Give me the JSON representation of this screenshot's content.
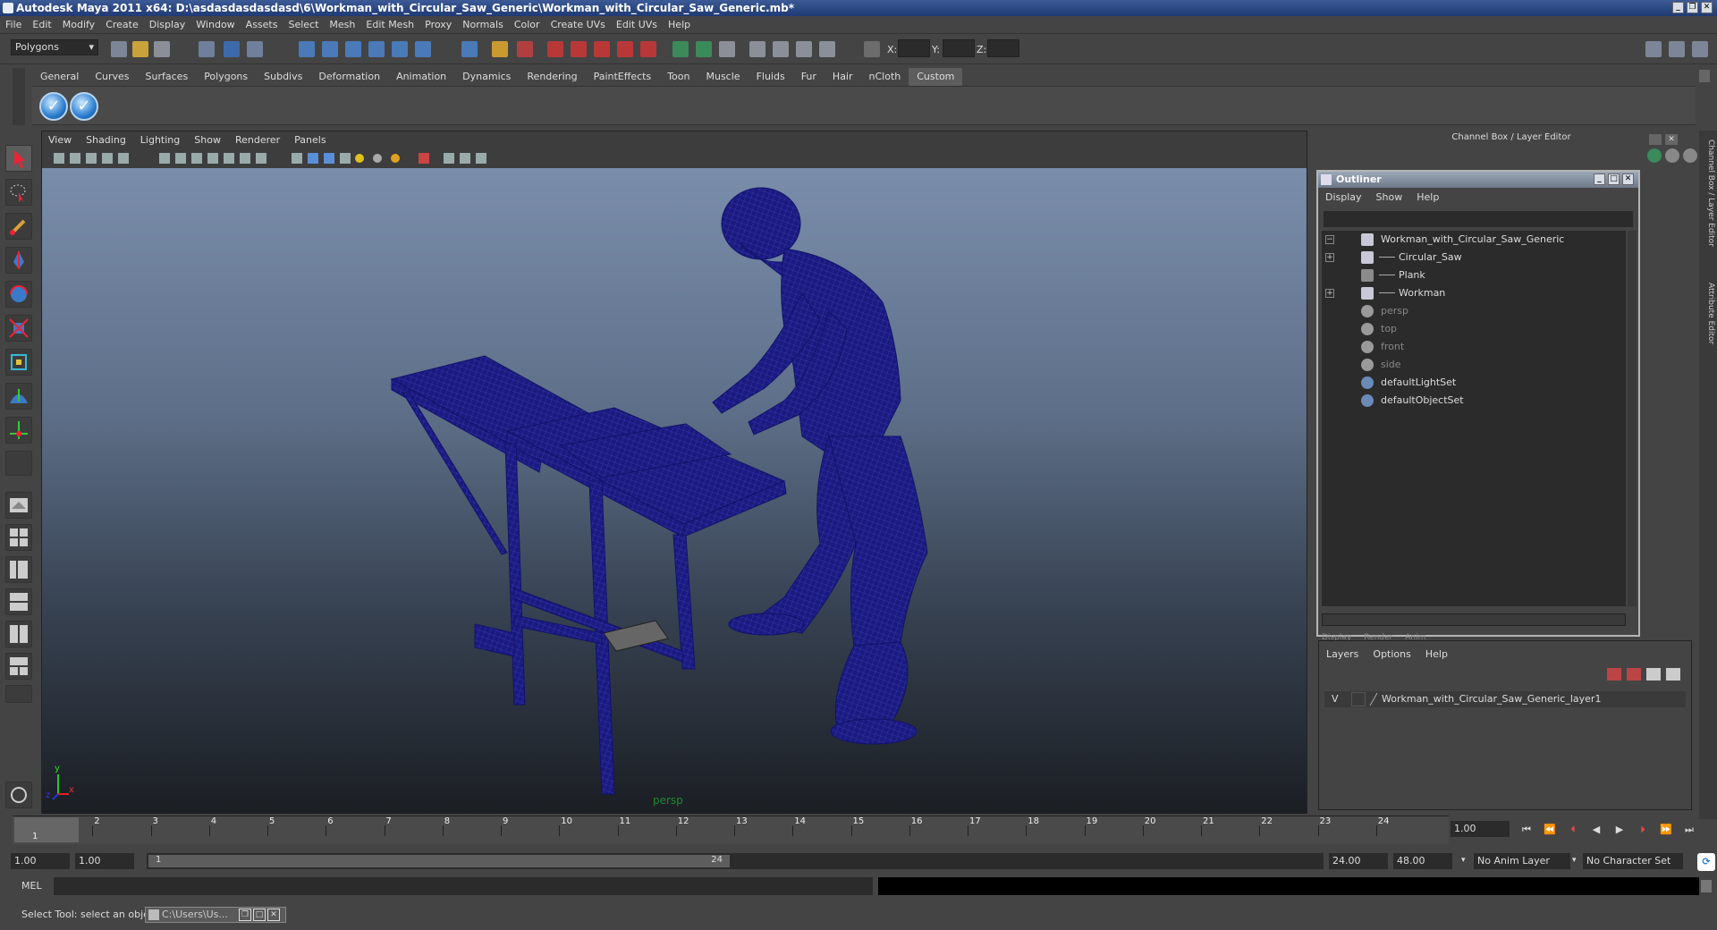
{
  "window": {
    "title": "Autodesk Maya 2011 x64: D:\\asdasdasdasdasd\\6\\Workman_with_Circular_Saw_Generic\\Workman_with_Circular_Saw_Generic.mb*"
  },
  "menubar": [
    "File",
    "Edit",
    "Modify",
    "Create",
    "Display",
    "Window",
    "Assets",
    "Select",
    "Mesh",
    "Edit Mesh",
    "Proxy",
    "Normals",
    "Color",
    "Create UVs",
    "Edit UVs",
    "Help"
  ],
  "status_line": {
    "mode": "Polygons",
    "x_label": "X:",
    "y_label": "Y:",
    "z_label": "Z:"
  },
  "shelf_tabs": [
    "General",
    "Curves",
    "Surfaces",
    "Polygons",
    "Subdivs",
    "Deformation",
    "Animation",
    "Dynamics",
    "Rendering",
    "PaintEffects",
    "Toon",
    "Muscle",
    "Fluids",
    "Fur",
    "Hair",
    "nCloth",
    "Custom"
  ],
  "active_shelf": "Custom",
  "viewport": {
    "menu": [
      "View",
      "Shading",
      "Lighting",
      "Show",
      "Renderer",
      "Panels"
    ],
    "camera": "persp",
    "axis_y": "y",
    "axis_x": "x",
    "axis_z": "z"
  },
  "channel_box": {
    "title": "Channel Box / Layer Editor"
  },
  "outliner": {
    "title": "Outliner",
    "menu": [
      "Display",
      "Show",
      "Help"
    ],
    "items": [
      {
        "label": "Workman_with_Circular_Saw_Generic",
        "expand": "−",
        "indent": 0,
        "icon": "transform-icon",
        "dim": false
      },
      {
        "label": "Circular_Saw",
        "expand": "+",
        "indent": 1,
        "icon": "transform-icon",
        "dim": false
      },
      {
        "label": "Plank",
        "expand": "",
        "indent": 1,
        "icon": "mesh-icon",
        "dim": false
      },
      {
        "label": "Workman",
        "expand": "+",
        "indent": 1,
        "icon": "transform-icon",
        "dim": false
      },
      {
        "label": "persp",
        "expand": "",
        "indent": 0,
        "icon": "camera-icon",
        "dim": true
      },
      {
        "label": "top",
        "expand": "",
        "indent": 0,
        "icon": "camera-icon",
        "dim": true
      },
      {
        "label": "front",
        "expand": "",
        "indent": 0,
        "icon": "camera-icon",
        "dim": true
      },
      {
        "label": "side",
        "expand": "",
        "indent": 0,
        "icon": "camera-icon",
        "dim": true
      },
      {
        "label": "defaultLightSet",
        "expand": "",
        "indent": 0,
        "icon": "set-icon",
        "dim": false
      },
      {
        "label": "defaultObjectSet",
        "expand": "",
        "indent": 0,
        "icon": "set-icon",
        "dim": false
      }
    ]
  },
  "layer_editor": {
    "tabs": [
      "Display",
      "Render",
      "Anim"
    ],
    "menu": [
      "Layers",
      "Options",
      "Help"
    ],
    "layer": {
      "visible": "V",
      "name": "Workman_with_Circular_Saw_Generic_layer1"
    }
  },
  "right_tabs": [
    "Channel Box / Layer Editor",
    "Attribute Editor"
  ],
  "time_slider": {
    "ticks": [
      "1",
      "2",
      "3",
      "4",
      "5",
      "6",
      "7",
      "8",
      "9",
      "10",
      "11",
      "12",
      "13",
      "14",
      "15",
      "16",
      "17",
      "18",
      "19",
      "20",
      "21",
      "22",
      "23",
      "24"
    ],
    "current_time": "1.00",
    "current_frame_label": "1"
  },
  "range": {
    "start": "1.00",
    "playback_start": "1.00",
    "handle_start": "1",
    "handle_end": "24",
    "playback_end": "24.00",
    "end": "48.00",
    "anim_layer": "No Anim Layer",
    "character_set": "No Character Set"
  },
  "command_line": {
    "label": "MEL"
  },
  "help_line": {
    "text": "Select Tool: select an object",
    "task": "C:\\Users\\Us..."
  },
  "colors": {
    "wire": "#1a1a80",
    "title_bar": "#2a4785"
  }
}
